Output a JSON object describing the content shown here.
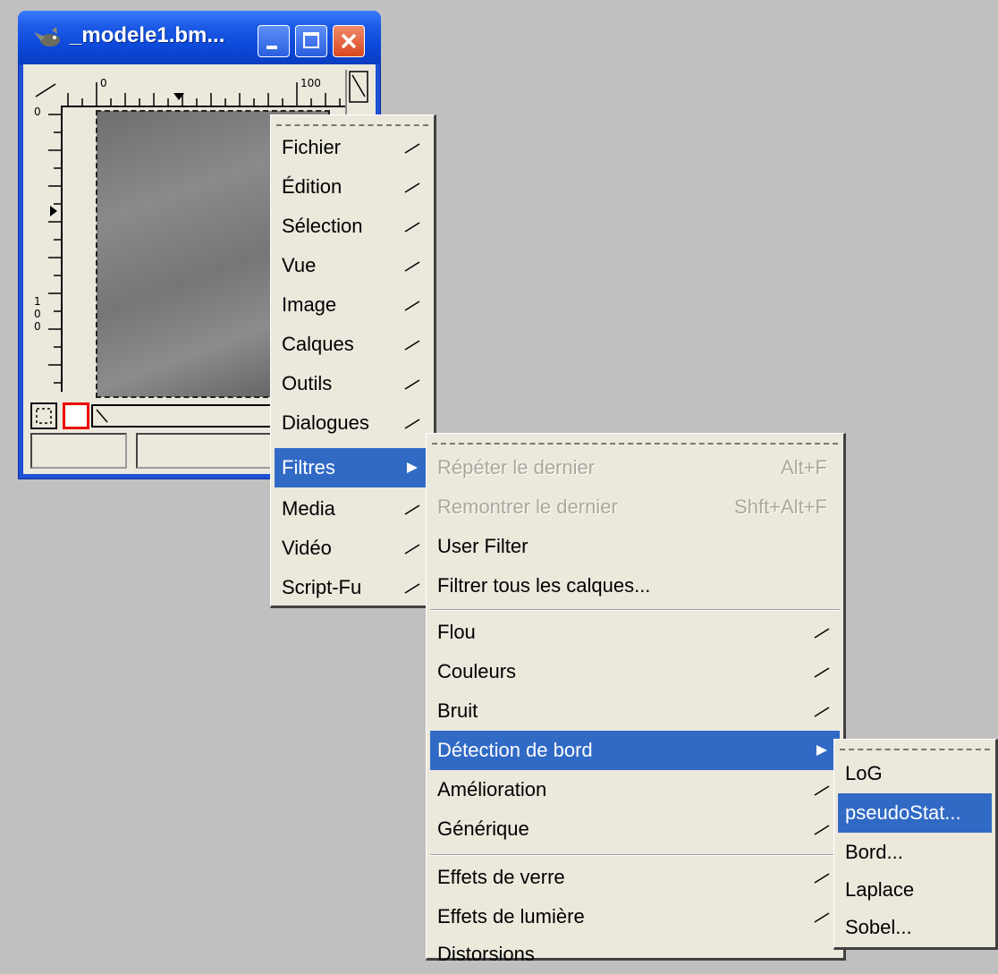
{
  "window": {
    "title": "_modele1.bm...",
    "ruler_h": [
      "0",
      "100"
    ],
    "ruler_v": [
      "0",
      "1",
      "0",
      "0"
    ]
  },
  "main_menu": {
    "items": [
      "Fichier",
      "Édition",
      "Sélection",
      "Vue",
      "Image",
      "Calques",
      "Outils",
      "Dialogues",
      "Filtres",
      "Media",
      "Vidéo",
      "Script-Fu"
    ],
    "selected": "Filtres"
  },
  "filters_menu": {
    "repeat_last": {
      "label": "Répéter le dernier",
      "shortcut": "Alt+F"
    },
    "reshow_last": {
      "label": "Remontrer le dernier",
      "shortcut": "Shft+Alt+F"
    },
    "user_filter": "User Filter",
    "filter_all_layers": "Filtrer tous les calques...",
    "submenus_1": [
      "Flou",
      "Couleurs",
      "Bruit",
      "Détection de bord",
      "Amélioration",
      "Générique"
    ],
    "submenus_2": [
      "Effets de verre",
      "Effets de lumière",
      "Distorsions"
    ],
    "selected": "Détection de bord"
  },
  "edge_menu": {
    "items": [
      "LoG",
      "pseudoStat...",
      "Bord...",
      "Laplace",
      "Sobel..."
    ],
    "selected": "pseudoStat..."
  },
  "colors": {
    "desktop": "#c0c0c0",
    "menu_bg": "#ebe8dc",
    "highlight": "#316ac5",
    "titlebar": "#0b47d8"
  }
}
